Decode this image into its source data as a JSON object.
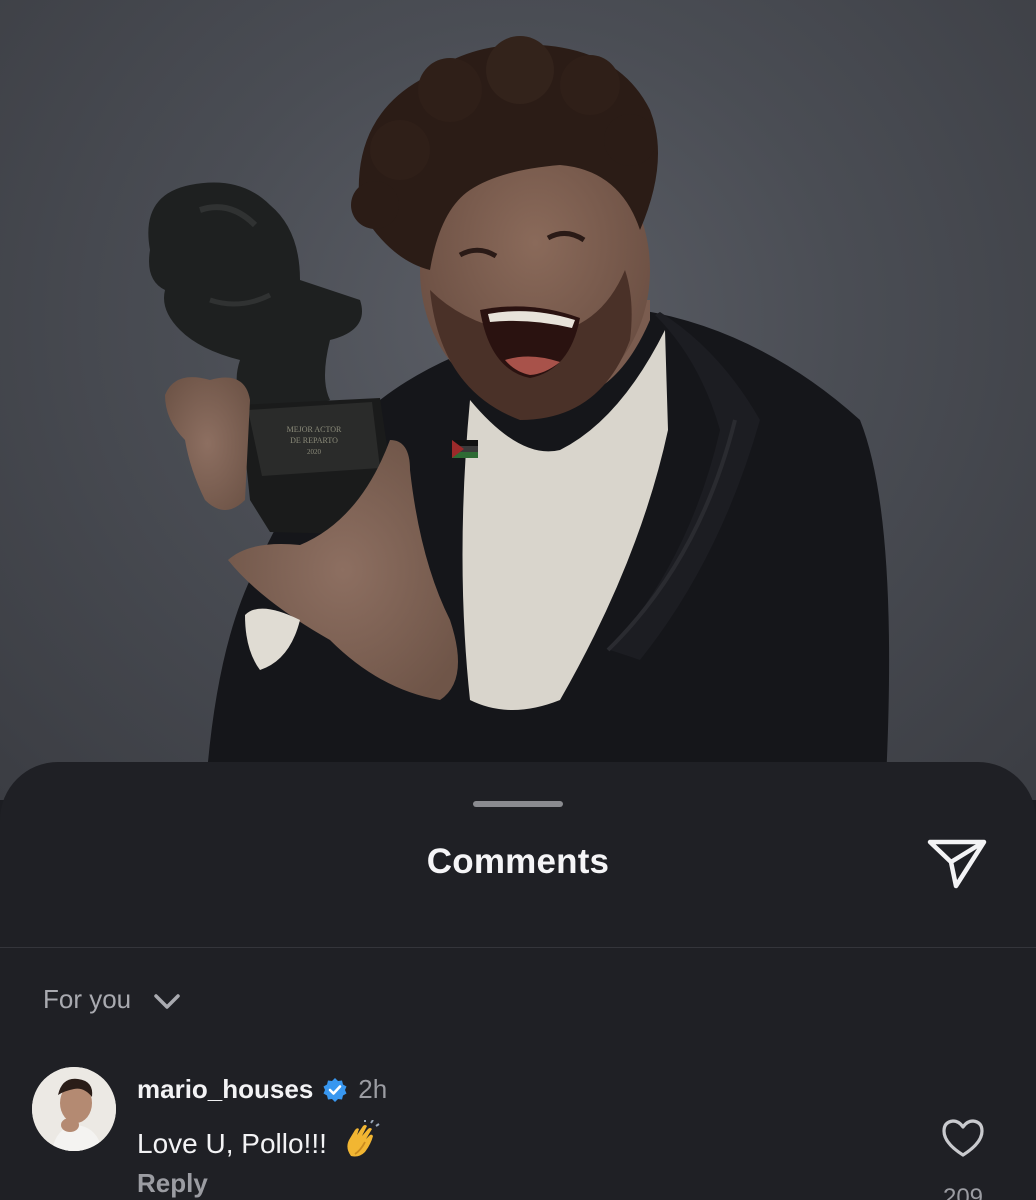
{
  "post": {
    "image_alt": "Man holding trophy",
    "trophy_inscription": [
      "MEJOR ACTOR",
      "DE REPARTO",
      "2020"
    ]
  },
  "sheet": {
    "title": "Comments",
    "filter_label": "For you"
  },
  "comments": [
    {
      "username": "mario_houses",
      "verified": true,
      "time": "2h",
      "text": "Love U, Pollo!!!",
      "emoji": "👏",
      "reply_label": "Reply",
      "like_count": "209"
    }
  ],
  "colors": {
    "sheet_background": "#1f2025",
    "primary_text": "#f3f3f5",
    "secondary_text": "#9b9ca2",
    "verified_badge": "#3897f0"
  },
  "icons": [
    "share-icon",
    "chevron-down-icon",
    "verified-badge-icon",
    "heart-icon",
    "clapping-hands-emoji"
  ]
}
